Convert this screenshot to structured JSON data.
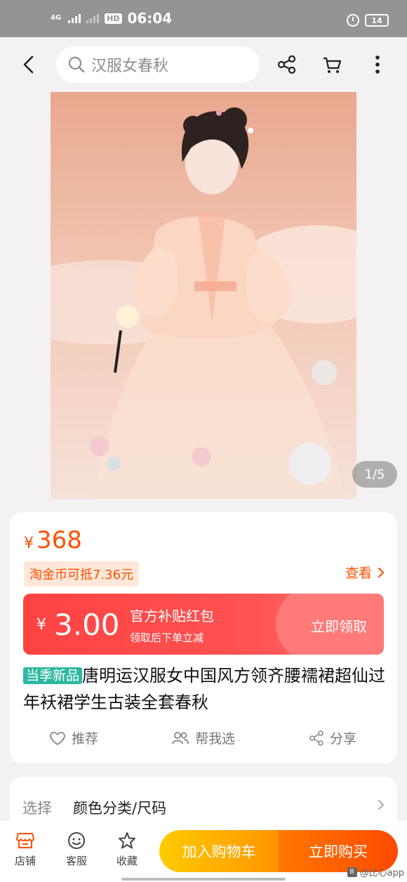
{
  "status_bar": {
    "network": "4G",
    "time": "06:04",
    "battery": "14"
  },
  "search": {
    "placeholder": "汉服女春秋"
  },
  "gallery": {
    "page_indicator": "1/5"
  },
  "price": {
    "symbol": "¥",
    "amount": "368"
  },
  "coin_offer": {
    "text": "淘金币可抵7.36元",
    "view_label": "查看"
  },
  "coupon": {
    "symbol": "¥",
    "amount": "3.00",
    "title": "官方补贴红包",
    "subtitle": "领取后下单立减",
    "action": "立即领取"
  },
  "product": {
    "badge": "当季新品",
    "title": "唐明运汉服女中国风方领齐腰襦裙超仙过年袄裙学生古装全套春秋"
  },
  "actions": [
    {
      "label": "推荐",
      "icon": "heart-icon"
    },
    {
      "label": "帮我选",
      "icon": "people-icon"
    },
    {
      "label": "分享",
      "icon": "share-icon"
    }
  ],
  "select_row": {
    "label": "选择",
    "value": "颜色分类/尺码"
  },
  "bottom_bar": {
    "tabs": [
      {
        "label": "店铺",
        "icon": "store-icon"
      },
      {
        "label": "客服",
        "icon": "service-icon"
      },
      {
        "label": "收藏",
        "icon": "star-icon"
      }
    ],
    "add_to_cart": "加入购物车",
    "buy_now": "立即购买"
  },
  "watermark": "@比心app"
}
